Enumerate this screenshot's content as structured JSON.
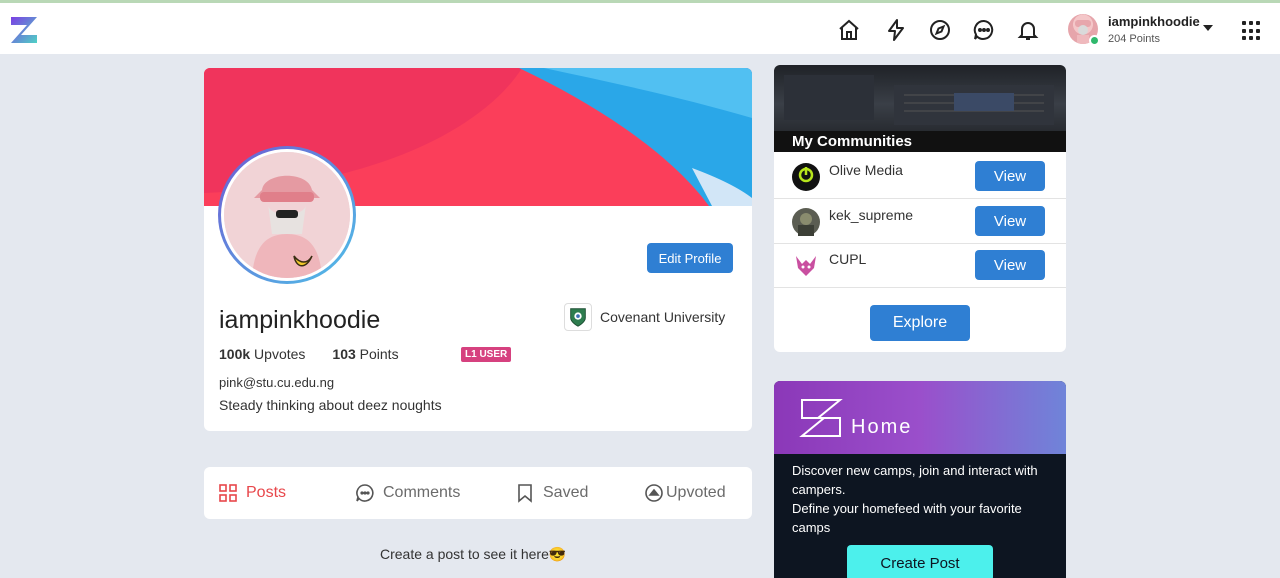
{
  "topbar": {
    "user": {
      "name": "iampinkhoodie",
      "points": "204 Points"
    },
    "icons": [
      "home-icon",
      "lightning-icon",
      "compass-icon",
      "chat-icon",
      "bell-icon",
      "apps-grid-icon"
    ]
  },
  "profile": {
    "username": "iampinkhoodie",
    "edit_label": "Edit Profile",
    "university": "Covenant University",
    "upvotes_value": "100k",
    "upvotes_label": " Upvotes",
    "points_value": "103",
    "points_label": " Points",
    "level": "L1 USER",
    "email": "pink@stu.cu.edu.ng",
    "bio": "Steady thinking about deez noughts"
  },
  "tabs": [
    {
      "label": "Posts",
      "active": true
    },
    {
      "label": "Comments",
      "active": false
    },
    {
      "label": "Saved",
      "active": false
    },
    {
      "label": "Upvoted",
      "active": false
    }
  ],
  "empty_message": "Create a post to see it here😎",
  "communities": {
    "title": "My Communities",
    "items": [
      {
        "name": "Olive Media",
        "action": "View"
      },
      {
        "name": "kek_supreme",
        "action": "View"
      },
      {
        "name": "CUPL",
        "action": "View"
      }
    ],
    "explore_label": "Explore"
  },
  "home_card": {
    "title": "Home",
    "line1": "Discover new camps, join and interact with campers.",
    "line2": "Define your homefeed with your favorite camps",
    "button": "Create Post"
  },
  "colors": {
    "accent_blue": "#2f7fd3",
    "active_tab": "#e8474b",
    "level_badge": "#d6417f",
    "create_button": "#4cf0ec"
  }
}
